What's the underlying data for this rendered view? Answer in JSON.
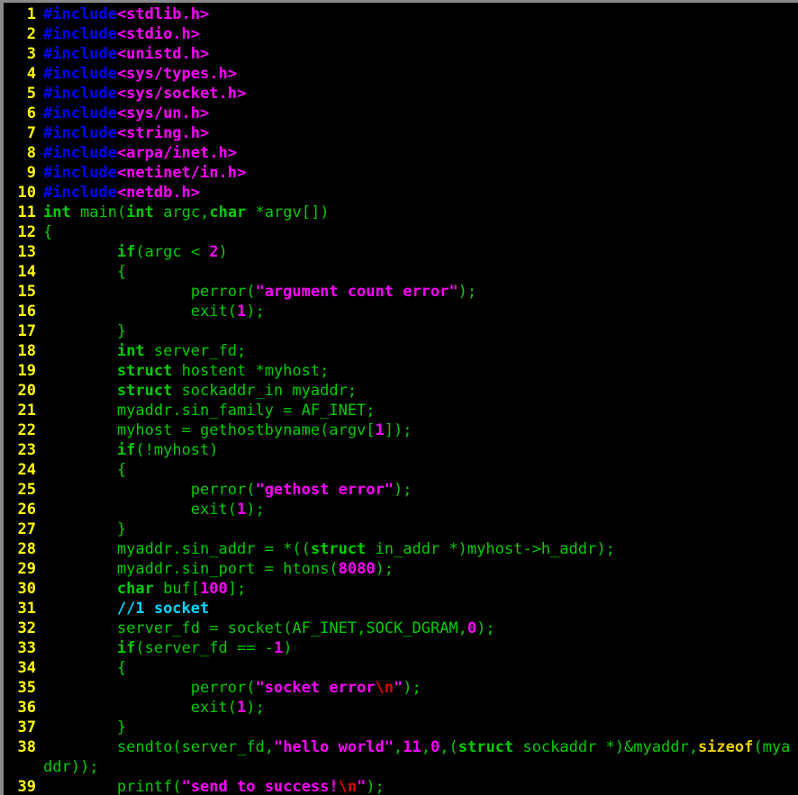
{
  "editor": {
    "title": "C source code viewer",
    "background_color": "#000000",
    "border_color": "#8a8a8a",
    "gutter_color": "#ffff00",
    "font_size_px": 17,
    "line_height_px": 22,
    "tab_width": 8
  },
  "palette": {
    "preprocessor": "#0000ff",
    "header_name": "#ff00ff",
    "keyword": "#00cc00",
    "identifier": "#00cc00",
    "string": "#ff00ff",
    "number": "#ff00ff",
    "escape": "#e00000",
    "comment": "#00d7ff",
    "sizeof": "#e8d000",
    "line_number": "#ffff00",
    "background": "#000000"
  },
  "lines": [
    {
      "n": "1",
      "wrapped": false,
      "text": "#include<stdlib.h>"
    },
    {
      "n": "2",
      "wrapped": false,
      "text": "#include<stdio.h>"
    },
    {
      "n": "3",
      "wrapped": false,
      "text": "#include<unistd.h>"
    },
    {
      "n": "4",
      "wrapped": false,
      "text": "#include<sys/types.h>"
    },
    {
      "n": "5",
      "wrapped": false,
      "text": "#include<sys/socket.h>"
    },
    {
      "n": "6",
      "wrapped": false,
      "text": "#include<sys/un.h>"
    },
    {
      "n": "7",
      "wrapped": false,
      "text": "#include<string.h>"
    },
    {
      "n": "8",
      "wrapped": false,
      "text": "#include<arpa/inet.h>"
    },
    {
      "n": "9",
      "wrapped": false,
      "text": "#include<netinet/in.h>"
    },
    {
      "n": "10",
      "wrapped": false,
      "text": "#include<netdb.h>"
    },
    {
      "n": "11",
      "wrapped": false,
      "text": "int main(int argc,char *argv[])"
    },
    {
      "n": "12",
      "wrapped": false,
      "text": "{"
    },
    {
      "n": "13",
      "wrapped": false,
      "text": "        if(argc < 2)"
    },
    {
      "n": "14",
      "wrapped": false,
      "text": "        {"
    },
    {
      "n": "15",
      "wrapped": false,
      "text": "                perror(\"argument count error\");"
    },
    {
      "n": "16",
      "wrapped": false,
      "text": "                exit(1);"
    },
    {
      "n": "17",
      "wrapped": false,
      "text": "        }"
    },
    {
      "n": "18",
      "wrapped": false,
      "text": "        int server_fd;"
    },
    {
      "n": "19",
      "wrapped": false,
      "text": "        struct hostent *myhost;"
    },
    {
      "n": "20",
      "wrapped": false,
      "text": "        struct sockaddr_in myaddr;"
    },
    {
      "n": "21",
      "wrapped": false,
      "text": "        myaddr.sin_family = AF_INET;"
    },
    {
      "n": "22",
      "wrapped": false,
      "text": "        myhost = gethostbyname(argv[1]);"
    },
    {
      "n": "23",
      "wrapped": false,
      "text": "        if(!myhost)"
    },
    {
      "n": "24",
      "wrapped": false,
      "text": "        {"
    },
    {
      "n": "25",
      "wrapped": false,
      "text": "                perror(\"gethost error\");"
    },
    {
      "n": "26",
      "wrapped": false,
      "text": "                exit(1);"
    },
    {
      "n": "27",
      "wrapped": false,
      "text": "        }"
    },
    {
      "n": "28",
      "wrapped": false,
      "text": "        myaddr.sin_addr = *((struct in_addr *)myhost->h_addr);"
    },
    {
      "n": "29",
      "wrapped": false,
      "text": "        myaddr.sin_port = htons(8080);"
    },
    {
      "n": "30",
      "wrapped": false,
      "text": "        char buf[100];"
    },
    {
      "n": "31",
      "wrapped": false,
      "text": "        //1 socket"
    },
    {
      "n": "32",
      "wrapped": false,
      "text": "        server_fd = socket(AF_INET,SOCK_DGRAM,0);"
    },
    {
      "n": "33",
      "wrapped": false,
      "text": "        if(server_fd == -1)"
    },
    {
      "n": "34",
      "wrapped": false,
      "text": "        {"
    },
    {
      "n": "35",
      "wrapped": false,
      "text": "                perror(\"socket error\\n\");"
    },
    {
      "n": "36",
      "wrapped": false,
      "text": "                exit(1);"
    },
    {
      "n": "37",
      "wrapped": false,
      "text": "        }"
    },
    {
      "n": "38",
      "wrapped": true,
      "text": "        sendto(server_fd,\"hello world\",11,0,(struct sockaddr *)&myaddr,sizeof(myaddr));"
    },
    {
      "n": "39",
      "wrapped": false,
      "text": "        printf(\"send to success!\\n\");"
    }
  ]
}
